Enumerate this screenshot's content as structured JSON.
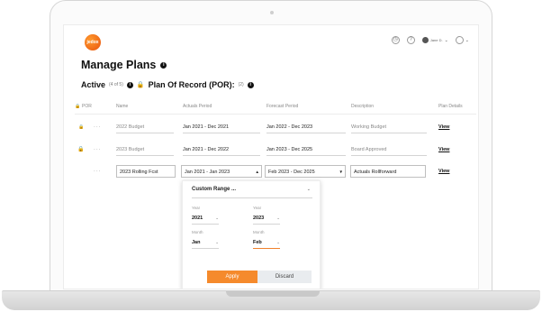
{
  "app": {
    "logo_text": "jedox"
  },
  "header": {
    "user_label": "Jane D.",
    "help_icon": "help-circle-icon",
    "clock_icon": "clock-icon",
    "account_icon": "account-icon"
  },
  "page": {
    "title": "Manage Plans",
    "active_label": "Active",
    "active_count": "(4 of 5)",
    "por_label": "Plan Of Record (POR):",
    "por_count": "(2)"
  },
  "table": {
    "headers": [
      "POR",
      "Name",
      "Actuals Period",
      "Forecast Period",
      "Description",
      "Plan Details"
    ],
    "rows": [
      {
        "name": "2022 Budget",
        "actuals": "Jan 2021 - Dec 2021",
        "forecast": "Jan 2022 - Dec 2023",
        "description": "Working Budget",
        "details": "View"
      },
      {
        "name": "2023 Budget",
        "actuals": "Jan 2021 - Dec 2022",
        "forecast": "Jan 2023 - Dec 2025",
        "description": "Board Approved",
        "details": "View"
      },
      {
        "name": "2023 Rolling Fcst",
        "actuals": "Jan 2021 - Jan 2023",
        "forecast": "Feb 2023 - Dec 2025",
        "description": "Actuals Rollforward",
        "details": "View"
      }
    ]
  },
  "dropdown": {
    "selection": "Custom Range ...",
    "from": {
      "year_label": "Year",
      "year": "2021",
      "month_label": "Month",
      "month": "Jan"
    },
    "to": {
      "year_label": "Year",
      "year": "2023",
      "month_label": "Month",
      "month": "Feb"
    },
    "apply_label": "Apply",
    "discard_label": "Discard"
  },
  "colors": {
    "accent": "#f58a2c",
    "text": "#111111",
    "muted": "#888888"
  }
}
